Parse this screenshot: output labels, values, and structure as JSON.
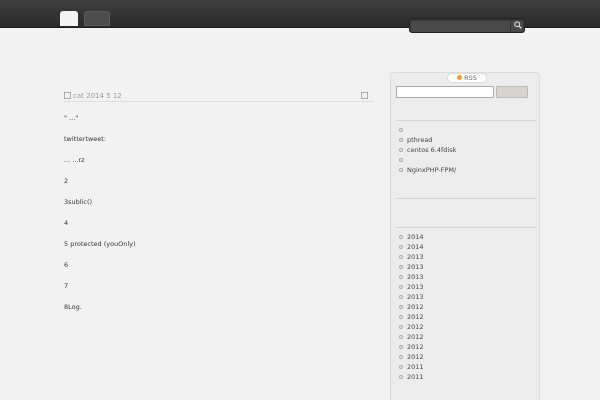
{
  "nav": {
    "tabs": [
      "",
      ""
    ]
  },
  "search": {
    "placeholder": ""
  },
  "site": {
    "title": "",
    "description": ""
  },
  "post": {
    "title": "",
    "author": "cat",
    "date": "2014  5  12 ",
    "comments": "",
    "paragraphs": [
      "",
      " \"  ...\"",
      "",
      "twittertweet:",
      "... ...rz",
      "",
      "2",
      "3sublic() ",
      "4",
      "5 protected (youOnly)",
      "6",
      "7",
      "8Log."
    ]
  },
  "sidebar": {
    "rss_label": "RSS ",
    "recent_title": "",
    "recent_posts": [
      "",
      "pthread",
      "centos 6.4fdisk",
      "",
      "NginxPHP-FPM/"
    ],
    "second_title": "",
    "archive_title": "",
    "archives": [
      "2014 ",
      "2014 ",
      "2013 ",
      "2013 ",
      "2013 ",
      "2013 ",
      "2013 ",
      "2012 ",
      "2012 ",
      "2012 ",
      "2012 ",
      "2012 ",
      "2012 ",
      "2011 ",
      "2011 "
    ]
  },
  "colors": {
    "topbar": "#333333",
    "page_background": "#f2f2f2",
    "rss_accent": "#f39c2c"
  }
}
